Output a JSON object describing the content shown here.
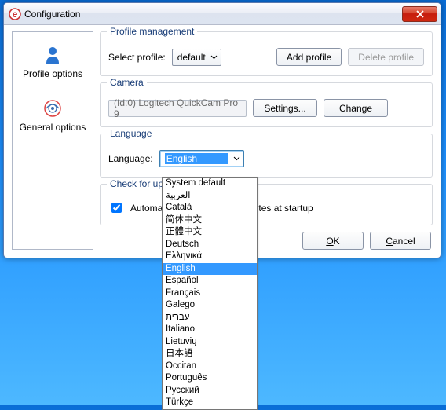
{
  "window": {
    "title": "Configuration"
  },
  "sidebar": {
    "items": [
      {
        "label": "Profile options"
      },
      {
        "label": "General options"
      }
    ]
  },
  "profile": {
    "group_title": "Profile management",
    "select_label": "Select profile:",
    "selected": "default",
    "add_btn": "Add profile",
    "delete_btn": "Delete profile"
  },
  "camera": {
    "group_title": "Camera",
    "device": "(Id:0) Logitech QuickCam Pro 9",
    "settings_btn": "Settings...",
    "change_btn": "Change"
  },
  "language": {
    "group_title": "Language",
    "label": "Language:",
    "selected": "English",
    "options": [
      "System default",
      "العربية",
      "Català",
      "简体中文",
      "正體中文",
      "Deutsch",
      "Ελληνικά",
      "English",
      "Español",
      "Français",
      "Galego",
      "עברית",
      "Italiano",
      "Lietuvių",
      "日本語",
      "Occitan",
      "Português",
      "Русский",
      "Türkçe"
    ]
  },
  "updates": {
    "group_title_prefix": "Check for up",
    "checkbox_prefix": "Automati",
    "checkbox_suffix": "tes at startup",
    "checked": true
  },
  "footer": {
    "ok": "OK",
    "cancel": "Cancel"
  }
}
